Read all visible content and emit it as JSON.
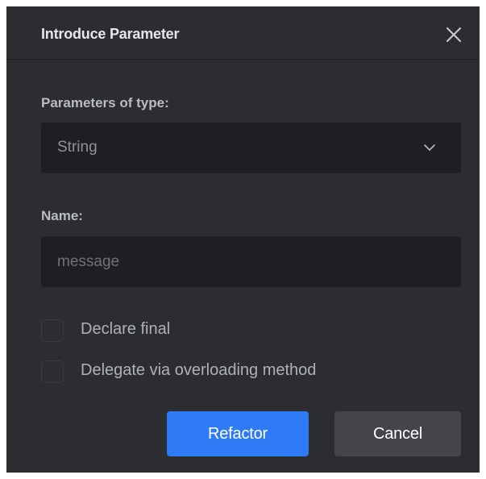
{
  "dialog": {
    "title": "Introduce Parameter",
    "close_icon": "close-icon"
  },
  "type_field": {
    "label": "Parameters of type:",
    "selected": "String",
    "dropdown_icon": "chevron-down-icon"
  },
  "name_field": {
    "label": "Name:",
    "value": "",
    "placeholder": "message"
  },
  "options": {
    "declare_final": {
      "label": "Declare final",
      "checked": false
    },
    "delegate_overloading": {
      "label": "Delegate via overloading method",
      "checked": false
    }
  },
  "buttons": {
    "refactor": "Refactor",
    "cancel": "Cancel"
  },
  "colors": {
    "dialog_bg": "#2b2d30",
    "input_bg": "#1e1f22",
    "primary": "#2f7bf5",
    "secondary": "#43454a"
  }
}
